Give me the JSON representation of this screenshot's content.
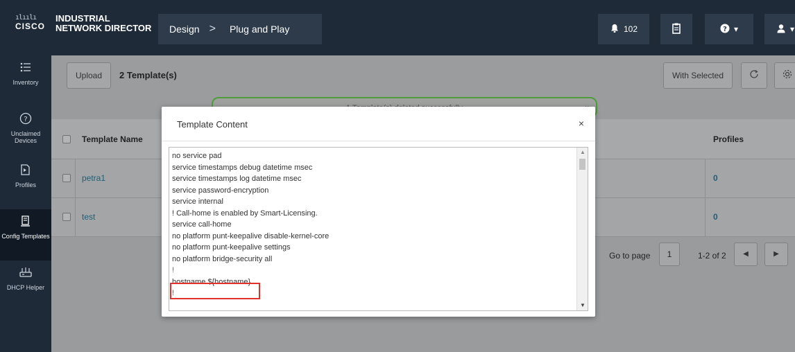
{
  "header": {
    "logo_bars": "ılıılı",
    "logo_word": "CISCO",
    "product_line1": "INDUSTRIAL",
    "product_line2": "NETWORK DIRECTOR",
    "breadcrumb": [
      "Design",
      "Plug and Play"
    ],
    "breadcrumb_sep": ">",
    "notifications_count": "102",
    "bell_icon": "bell-icon",
    "clipboard_icon": "clipboard-icon",
    "help_icon": "help-icon",
    "user_icon": "user-icon",
    "dropdown_caret": "▾"
  },
  "sidebar": {
    "items": [
      {
        "label": "Inventory",
        "icon": "list-icon",
        "glyph": "☰"
      },
      {
        "label": "Unclaimed Devices",
        "icon": "question-circle-icon",
        "glyph": "?"
      },
      {
        "label": "Profiles",
        "icon": "profile-icon",
        "glyph": "▷"
      },
      {
        "label": "Config Templates",
        "icon": "template-icon",
        "glyph": "▤",
        "active": true
      },
      {
        "label": "DHCP Helper",
        "icon": "router-icon",
        "glyph": "⌸"
      }
    ]
  },
  "toolbar": {
    "upload_label": "Upload",
    "template_count": "2 Template(s)",
    "with_selected_label": "With Selected",
    "refresh_icon": "refresh-icon",
    "settings_icon": "gear-icon"
  },
  "alert": {
    "message": "1 Template(s) deleted successfully",
    "close": "x",
    "color": "#4f9c3a"
  },
  "table": {
    "columns": [
      "Template Name",
      "Profiles"
    ],
    "rows": [
      {
        "name": "petra1",
        "profiles": "0"
      },
      {
        "name": "test",
        "profiles": "0"
      }
    ]
  },
  "pagination": {
    "goto_label": "Go to page",
    "page_value": "1",
    "range": "1-2 of 2",
    "prev": "◀",
    "next": "▶"
  },
  "modal": {
    "title": "Template Content",
    "close": "×",
    "lines": [
      "no service pad",
      "service timestamps debug datetime msec",
      "service timestamps log datetime msec",
      "service password-encryption",
      "service internal",
      "! Call-home is enabled by Smart-Licensing.",
      "service call-home",
      "no platform punt-keepalive disable-kernel-core",
      "no platform punt-keepalive settings",
      "no platform bridge-security all",
      "!",
      "hostname ${hostname}",
      "!"
    ],
    "highlight_color": "#e0302a"
  }
}
